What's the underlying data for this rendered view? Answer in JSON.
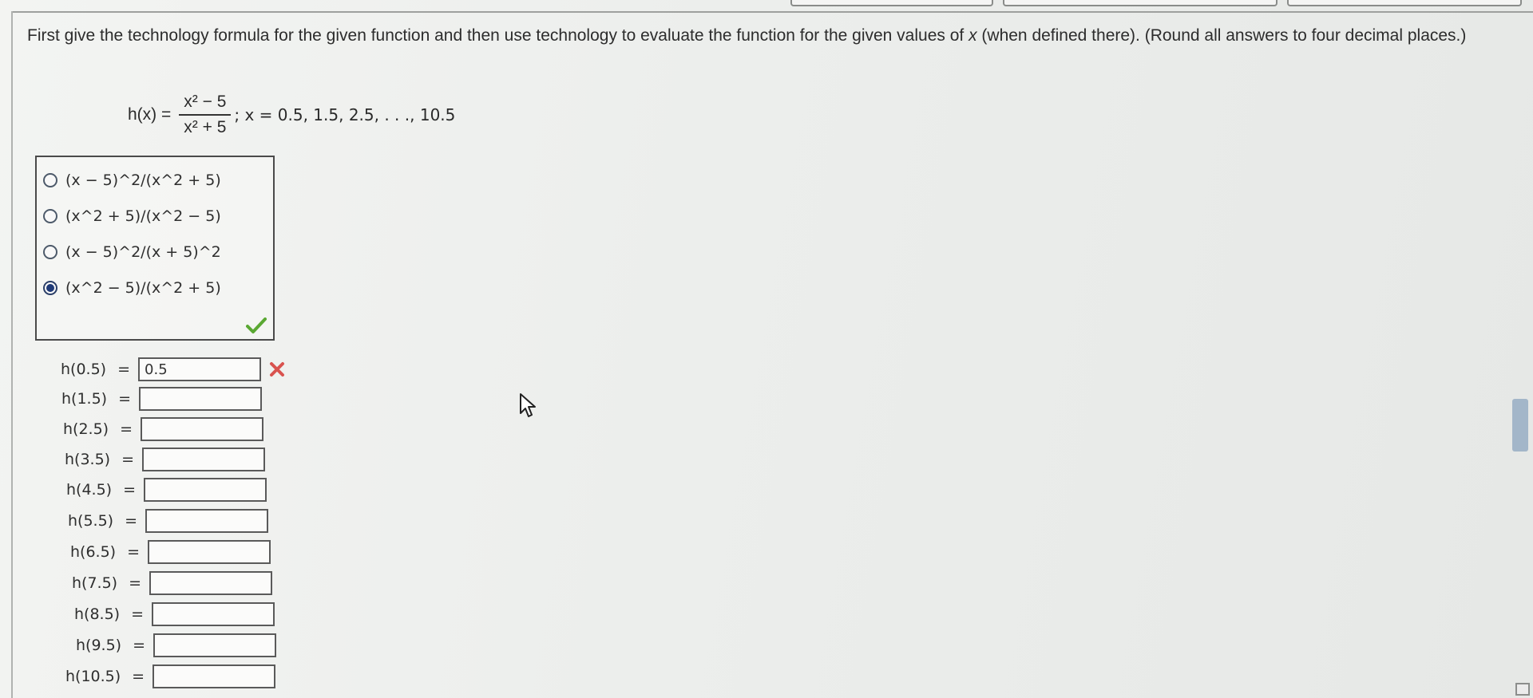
{
  "instructions": {
    "part1": "First give the technology formula for the given function and then use technology to evaluate the function for the given values of ",
    "var": "x",
    "part2": " (when defined there). (Round all answers to four decimal places.)"
  },
  "formula": {
    "lhs": "h(x) =",
    "numerator": "x² − 5",
    "denominator": "x² + 5",
    "rhs": "; x = 0.5, 1.5, 2.5, . . ., 10.5"
  },
  "choices": [
    {
      "label": "(x − 5)^2/(x^2 + 5)",
      "selected": false
    },
    {
      "label": "(x^2 + 5)/(x^2 − 5)",
      "selected": false
    },
    {
      "label": "(x − 5)^2/(x + 5)^2",
      "selected": false
    },
    {
      "label": "(x^2 − 5)/(x^2 + 5)",
      "selected": true
    }
  ],
  "choice_status": "correct",
  "evaluations": [
    {
      "label": "h(0.5)",
      "eq": "=",
      "value": "0.5",
      "status": "incorrect"
    },
    {
      "label": "h(1.5)",
      "eq": "=",
      "value": "",
      "status": ""
    },
    {
      "label": "h(2.5)",
      "eq": "=",
      "value": "",
      "status": ""
    },
    {
      "label": "h(3.5)",
      "eq": "=",
      "value": "",
      "status": ""
    },
    {
      "label": "h(4.5)",
      "eq": "=",
      "value": "",
      "status": ""
    },
    {
      "label": "h(5.5)",
      "eq": "=",
      "value": "",
      "status": ""
    },
    {
      "label": "h(6.5)",
      "eq": "=",
      "value": "",
      "status": ""
    },
    {
      "label": "h(7.5)",
      "eq": "=",
      "value": "",
      "status": ""
    },
    {
      "label": "h(8.5)",
      "eq": "=",
      "value": "",
      "status": ""
    },
    {
      "label": "h(9.5)",
      "eq": "=",
      "value": "",
      "status": ""
    },
    {
      "label": "h(10.5)",
      "eq": "=",
      "value": "",
      "status": ""
    }
  ],
  "colors": {
    "correct": "#5aa832",
    "incorrect": "#d9534f",
    "radio_selected": "#1f3a78"
  }
}
